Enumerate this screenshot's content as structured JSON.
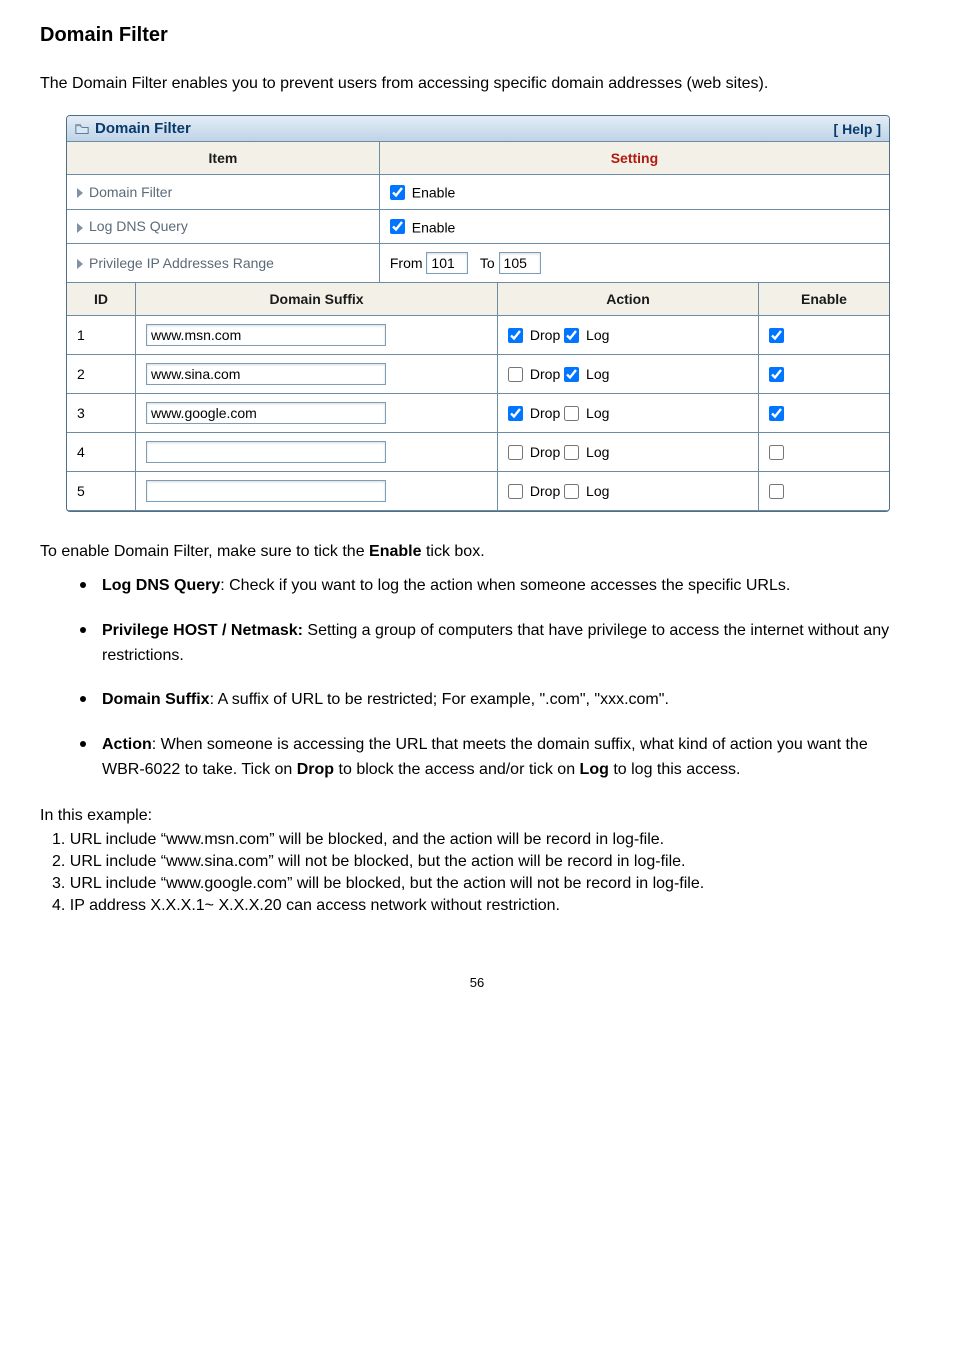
{
  "heading": "Domain Filter",
  "intro": "The Domain Filter enables you to prevent users from accessing specific domain addresses (web sites).",
  "panel": {
    "title": "Domain Filter",
    "help": "[ Help ]",
    "col_item": "Item",
    "col_setting": "Setting",
    "rows": {
      "domain_filter": {
        "label": "Domain Filter",
        "enable_label": "Enable",
        "checked": true
      },
      "log_dns": {
        "label": "Log DNS Query",
        "enable_label": "Enable",
        "checked": true
      },
      "ip_range": {
        "label": "Privilege IP Addresses Range",
        "from_label": "From",
        "from_value": "101",
        "to_label": "To",
        "to_value": "105"
      }
    },
    "headers": {
      "id": "ID",
      "suffix": "Domain Suffix",
      "action": "Action",
      "enable": "Enable"
    },
    "action_labels": {
      "drop": "Drop",
      "log": "Log"
    },
    "entries": [
      {
        "id": "1",
        "suffix": "www.msn.com",
        "drop": true,
        "log": true,
        "enable": true
      },
      {
        "id": "2",
        "suffix": "www.sina.com",
        "drop": false,
        "log": true,
        "enable": true
      },
      {
        "id": "3",
        "suffix": "www.google.com",
        "drop": true,
        "log": false,
        "enable": true
      },
      {
        "id": "4",
        "suffix": "",
        "drop": false,
        "log": false,
        "enable": false
      },
      {
        "id": "5",
        "suffix": "",
        "drop": false,
        "log": false,
        "enable": false
      }
    ]
  },
  "note_before": "To enable Domain Filter, make sure to tick the ",
  "note_bold": "Enable",
  "note_after": " tick box.",
  "bullets": [
    {
      "b": "Log DNS Query",
      "t": ": Check if you want to log the action when someone accesses the specific URLs."
    },
    {
      "b": "Privilege HOST / Netmask:",
      "t": " Setting a group of computers that have privilege to access the internet without any restrictions."
    },
    {
      "b": "Domain Suffix",
      "t": ": A suffix of URL to be restricted; For example, \".com\", \"xxx.com\"."
    },
    {
      "b": "Action",
      "t": ": When someone is accessing the URL that meets the domain suffix, what kind of action you want the WBR-6022 to take. Tick on ",
      "b2": "Drop",
      "t2": " to block the access and/or tick on ",
      "b3": "Log",
      "t3": " to log this access."
    }
  ],
  "example": {
    "title": "In this example:",
    "lines": [
      "1. URL include “www.msn.com” will be blocked, and the action will be record in log-file.",
      "2. URL include “www.sina.com” will not be blocked, but the action will be record in log-file.",
      "3. URL include “www.google.com” will be blocked, but the action will not be record in log-file.",
      "4. IP address X.X.X.1~ X.X.X.20 can access network without restriction."
    ]
  },
  "pageno": "56"
}
